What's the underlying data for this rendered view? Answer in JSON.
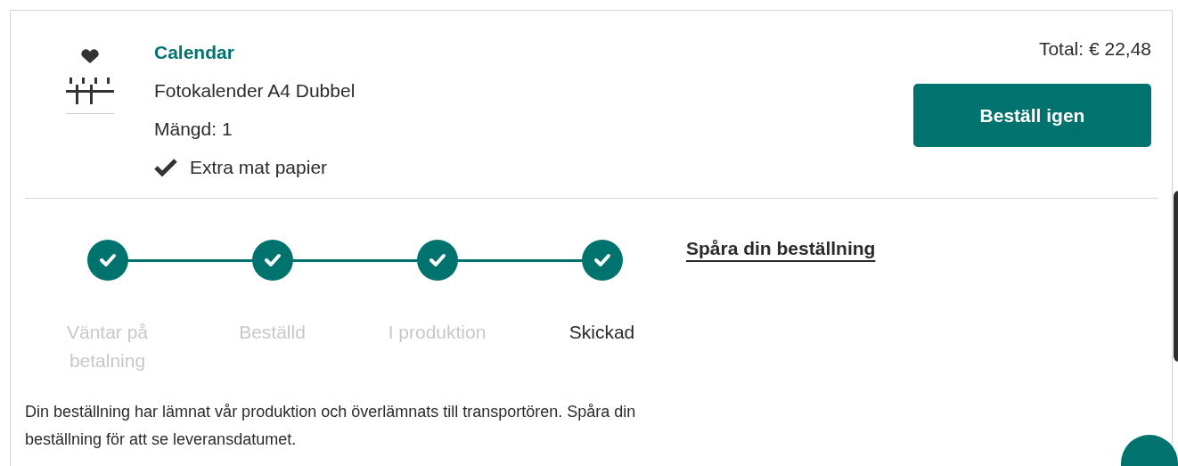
{
  "product": {
    "category": "Calendar",
    "name": "Fotokalender A4 Dubbel",
    "quantity": "Mängd: 1",
    "options": [
      {
        "label": "Extra mat papier",
        "checked": true
      }
    ]
  },
  "total": "Total: € 22,48",
  "reorder_button": "Beställ igen",
  "progress": {
    "steps": [
      {
        "label": "Väntar på betalning",
        "done": true,
        "selected": false
      },
      {
        "label": "Beställd",
        "done": true,
        "selected": false
      },
      {
        "label": "I produktion",
        "done": true,
        "selected": false
      },
      {
        "label": "Skickad",
        "done": true,
        "selected": true
      }
    ]
  },
  "track_link": "Spåra din beställning",
  "description": "Din beställning har lämnat vår produktion och överlämnats till transportören. Spåra din beställning för att se leveransdatumet."
}
